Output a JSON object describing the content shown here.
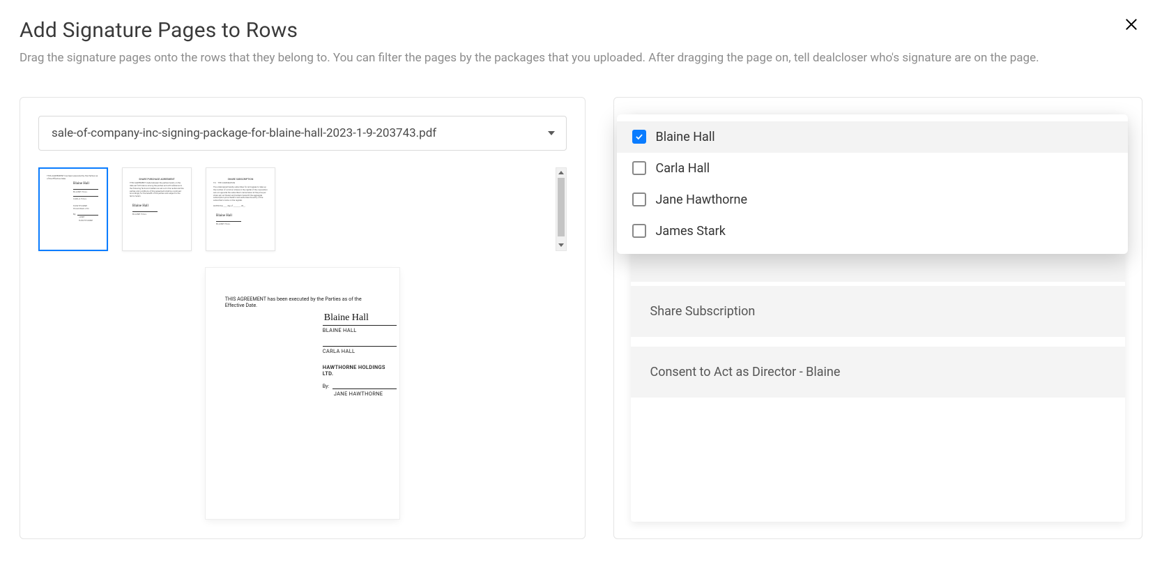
{
  "header": {
    "title": "Add Signature Pages to Rows",
    "subtitle": "Drag the signature pages onto the rows that they belong to. You can filter the pages by the packages that you uploaded. After dragging the page on, tell dealcloser who's signature are on the page."
  },
  "dropdown": {
    "selected": "sale-of-company-inc-signing-package-for-blaine-hall-2023-1-9-203743.pdf"
  },
  "preview": {
    "agreement_line": "THIS AGREEMENT has been executed by the Parties as of the Effective Date.",
    "signature_name_cursive": "Blaine Hall",
    "labels": {
      "blaine": "BLAINE HALL",
      "carla": "CARLA HALL",
      "hawthorne": "HAWTHORNE HOLDINGS LTD.",
      "by": "By:",
      "jane": "JANE HAWTHORNE"
    }
  },
  "thumbs": {
    "t2_title": "SHARE PURCHASE AGREEMENT",
    "t3_title": "SHARE SUBSCRIPTION"
  },
  "signers": [
    {
      "name": "Blaine Hall",
      "checked": true
    },
    {
      "name": "Carla Hall",
      "checked": false
    },
    {
      "name": "Jane Hawthorne",
      "checked": false
    },
    {
      "name": "James Stark",
      "checked": false
    }
  ],
  "documents": [
    {
      "title": "Share Subscription"
    },
    {
      "title": "Consent to Act as Director - Blaine"
    }
  ],
  "colors": {
    "accent": "#0a7cff"
  }
}
